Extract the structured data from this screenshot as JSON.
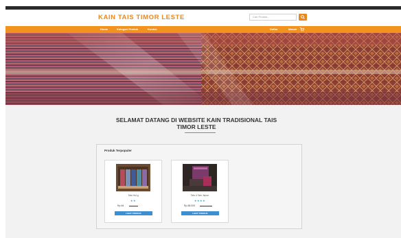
{
  "header": {
    "brand": "KAIN TAIS TIMOR LESTE",
    "search_placeholder": "Cari Produk...",
    "search_icon": "magnifier-icon"
  },
  "nav": {
    "left": [
      "Home",
      "Kategori Produk",
      "Kontak"
    ],
    "right": [
      "Daftar",
      "Masuk"
    ],
    "cart_icon": "cart-icon"
  },
  "main": {
    "welcome_line1": "SELAMAT DATANG DI WEBSITE KAIN TRADISIONAL TAIS",
    "welcome_line2": "TIMOR LESTE",
    "panel_title": "Produk Terpopuler",
    "products": [
      {
        "name": "Tais Hol.g",
        "stars": "★★",
        "price": "Rp.64",
        "button": "LIHAT PRODUK"
      },
      {
        "name": "Tais 4 Tais Jepun",
        "stars": "★★★★",
        "price": "Rp.68.000",
        "button": "LIHAT PRODUK"
      }
    ]
  },
  "colors": {
    "accent": "#f3931f",
    "brand": "#e8891f",
    "button": "#3d8fd1"
  }
}
